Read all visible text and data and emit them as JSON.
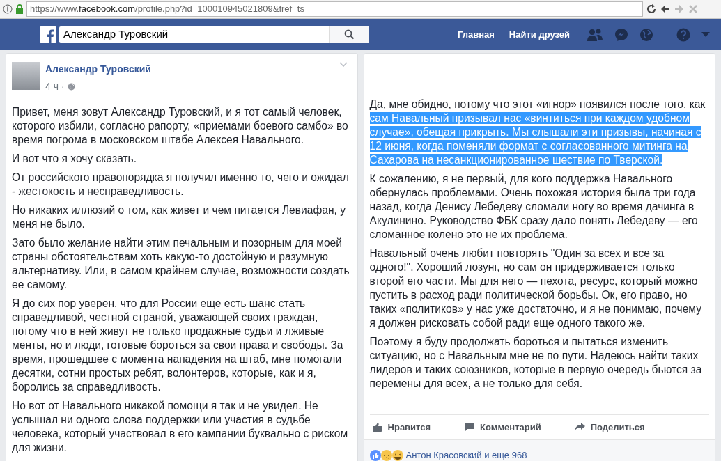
{
  "browser": {
    "url_host": "https://www.",
    "url_domain": "facebook.com",
    "url_path": "/profile.php?id=100010945021809&fref=ts"
  },
  "navbar": {
    "search_value": "Александр Туровский",
    "links": [
      "Главная",
      "Найти друзей"
    ]
  },
  "post": {
    "author": "Александр Туровский",
    "time": "4 ч",
    "separator": "·",
    "paragraphs": [
      "Привет, меня зовут Александр Туровский, и я тот самый человек, которого избили, согласно рапорту, «приемами боевого самбо» во время погрома в московском штабе Алексея Навального.",
      "И вот что я хочу сказать.",
      "От российского правопорядка я получил именно то, чего и ожидал - жестокость и несправедливость.",
      "Но никаких иллюзий о том, как живет и чем питается Левиафан, у меня не было.",
      "Зато было желание найти этим печальным и позорным для моей страны обстоятельствам хоть какую-то достойную и разумную альтернативу. Или, в самом крайнем случае, возможности создать ее самому.",
      "Я до сих пор уверен, что для России еще есть шанс стать справедливой, честной страной, уважающей своих граждан, потому что в ней живут не только продажные судьи и лживые менты, но и люди, готовые бороться за свои права и свободы. За время, прошедшее с момента нападения на штаб, мне помогали десятки, сотни простых ребят, волонтеров, которые, как и я, боролись за справедливость.",
      "Но вот от Навального никакой помощи я так и не увидел. Не услышал ни одного слова поддержки или участия в судьбе человека, который участвовал в его кампании буквально с риском для жизни."
    ]
  },
  "continuation": {
    "paragraphs": [
      [
        {
          "text": "Да, мне обидно, потому что этот «игнор» появился после того, как ",
          "selected": false
        },
        {
          "text": "сам Навальный призывал нас «винтиться при каждом удобном случае», обещая прикрыть. Мы слышали эти призывы, начиная с 12 июня, когда поменяли формат с согласованного митинга на Сахарова на несанкционированное шествие по Тверской.",
          "selected": true
        }
      ],
      [
        {
          "text": "К сожалению, я не первый, для кого поддержка Навального обернулась проблемами. Очень похожая история была три года назад, когда Денису Лебедеву сломали ногу во время дачинга в Акулинино. Руководство ФБК сразу дало понять Лебедеву — его сломанное колено это не их проблема.",
          "selected": false
        }
      ],
      [
        {
          "text": "Навальный очень любит повторять \"Один за всех и все за одного!\". Хороший лозунг, но сам он придерживается только второй его части. Мы для него — пехота, ресурс, который можно пустить в расход ради политической борьбы. Ок, его право, но таких «политиков» у нас уже достаточно, и я не понимаю, почему я должен рисковать собой ради еще одного такого же.",
          "selected": false
        }
      ],
      [
        {
          "text": "Поэтому я буду продолжать бороться и пытаться изменить ситуацию, но с Навальным мне не по пути. Надеюсь найти таких лидеров и таких союзников, которые в первую очередь бьются за перемены для всех, а не только для себя.",
          "selected": false
        }
      ]
    ],
    "actions": [
      {
        "kind": "like",
        "label": "Нравится"
      },
      {
        "kind": "comment",
        "label": "Комментарий"
      },
      {
        "kind": "share",
        "label": "Поделиться"
      }
    ],
    "reactions": "Антон Красовский и еще 968"
  }
}
